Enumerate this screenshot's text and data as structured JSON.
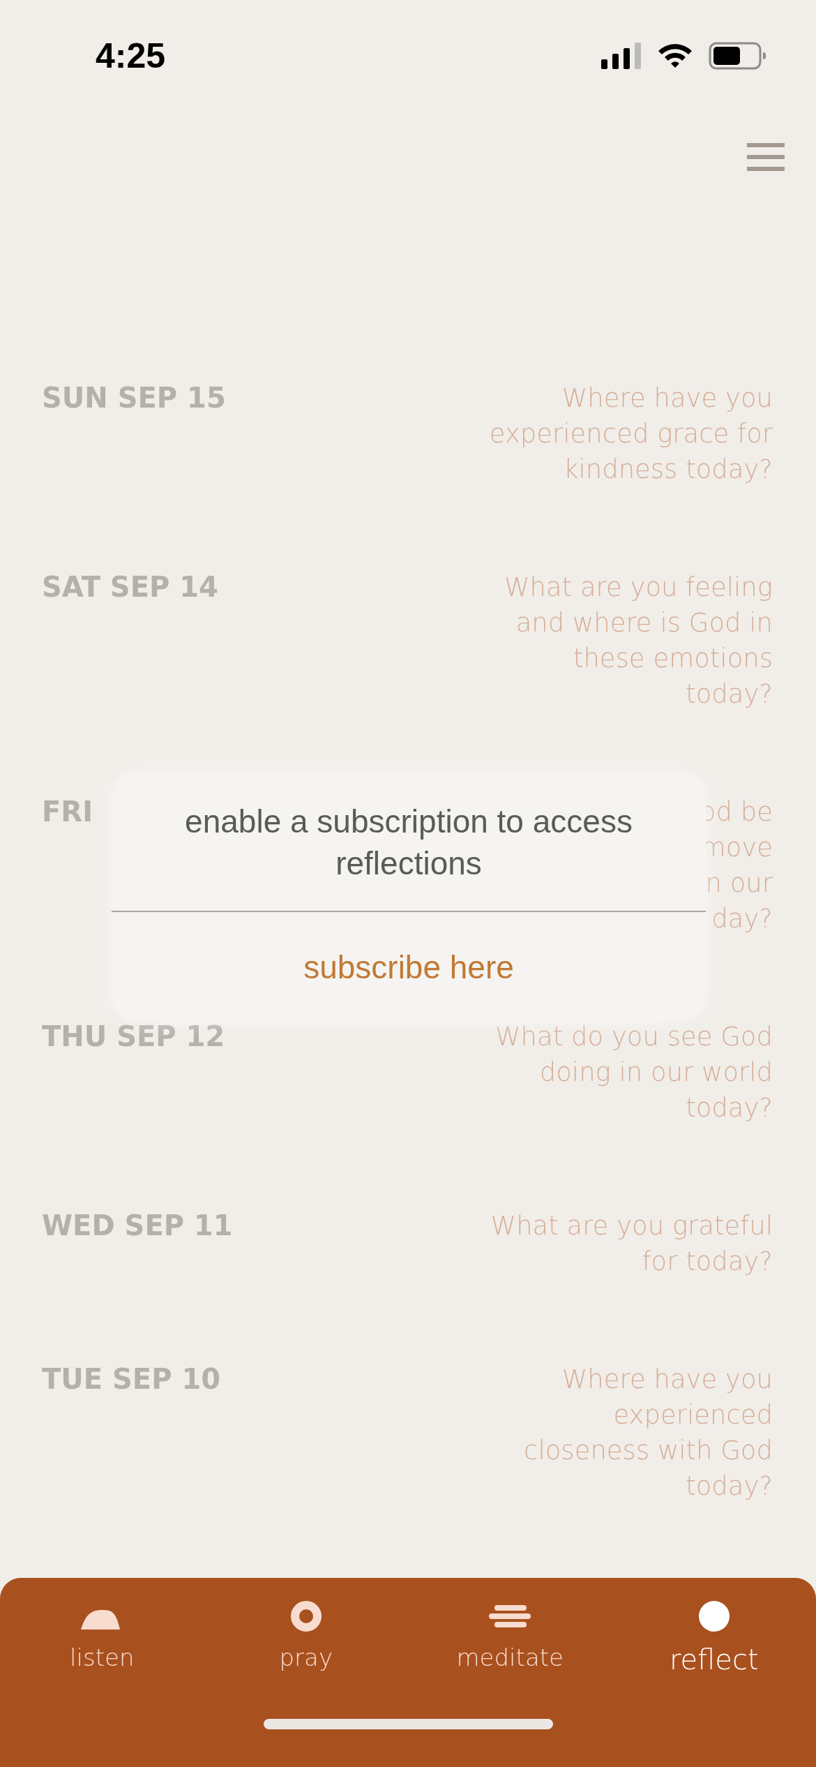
{
  "status_bar": {
    "time": "4:25"
  },
  "reflections": [
    {
      "date": "SUN SEP 15",
      "question": [
        "Where have you",
        "experienced grace for",
        "kindness today?"
      ]
    },
    {
      "date": "SAT SEP 14",
      "question": [
        "What are you feeling",
        "and where is God in",
        "these emotions",
        "today?"
      ]
    },
    {
      "date": "FRI",
      "question": [
        "od be",
        "move",
        "n our",
        "day?"
      ]
    },
    {
      "date": "THU SEP 12",
      "question": [
        "What do you see God",
        "doing in our world",
        "today?"
      ]
    },
    {
      "date": "WED SEP 11",
      "question": [
        "What are you grateful",
        "for today?"
      ]
    },
    {
      "date": "TUE SEP 10",
      "question": [
        "Where have you",
        "experienced",
        "closeness with God",
        "today?"
      ]
    }
  ],
  "dialog": {
    "message": "enable a subscription to access reflections",
    "action": "subscribe here"
  },
  "tabs": [
    {
      "label": "listen",
      "selected": false
    },
    {
      "label": "pray",
      "selected": false
    },
    {
      "label": "meditate",
      "selected": false
    },
    {
      "label": "reflect",
      "selected": true
    }
  ]
}
